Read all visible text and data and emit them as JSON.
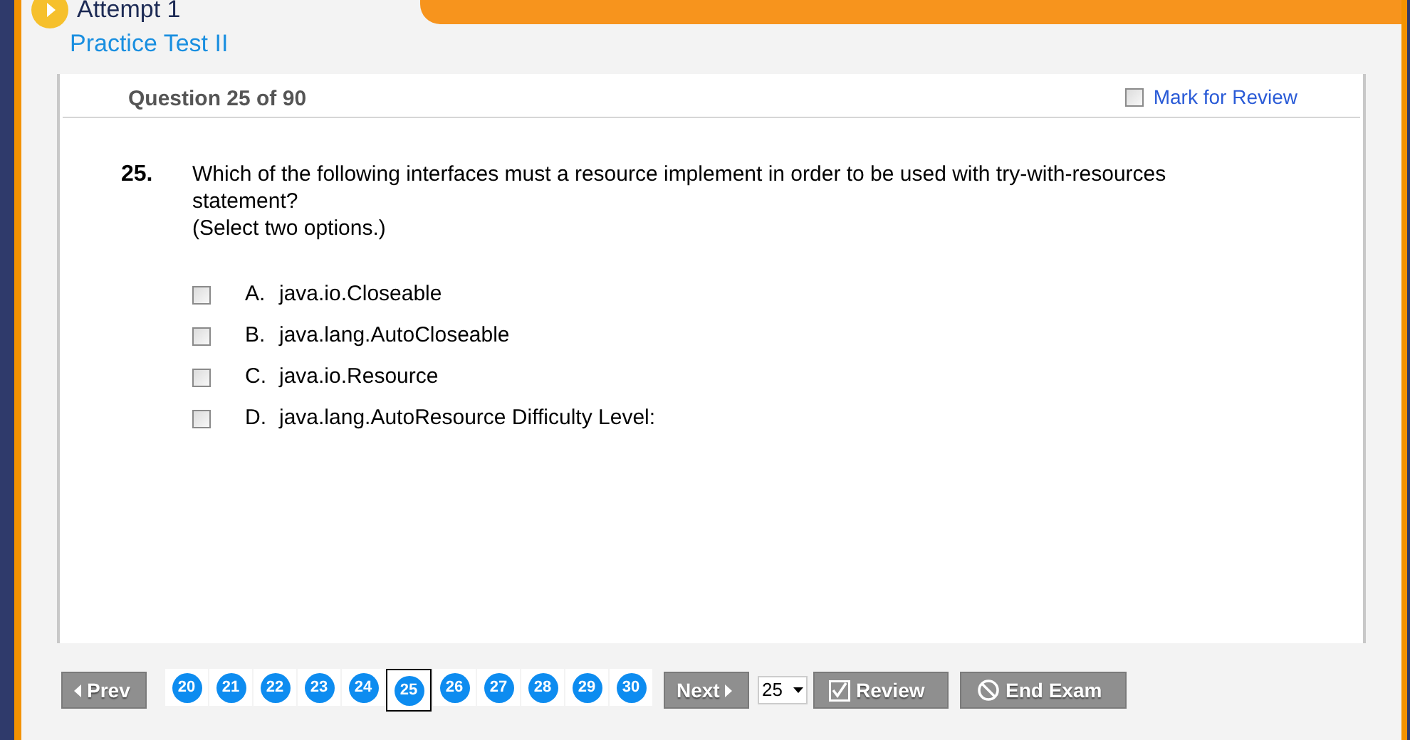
{
  "header": {
    "attempt": "Attempt 1",
    "test_name": "Practice Test II"
  },
  "question": {
    "heading": "Question 25 of 90",
    "mark_for_review": {
      "label": "Mark for Review",
      "checked": false
    },
    "number": "25.",
    "text": "Which of the following interfaces must a resource implement in order to be used with try-with-resources statement?",
    "instruction": "(Select two options.)",
    "options": [
      {
        "letter": "A.",
        "text": "java.io.Closeable",
        "checked": false
      },
      {
        "letter": "B.",
        "text": "java.lang.AutoCloseable",
        "checked": false
      },
      {
        "letter": "C.",
        "text": "java.io.Resource",
        "checked": false
      },
      {
        "letter": "D.",
        "text": "java.lang.AutoResource Difficulty Level:",
        "checked": false
      }
    ]
  },
  "footer": {
    "prev": "Prev",
    "pages": [
      {
        "label": "20",
        "selected": false
      },
      {
        "label": "21",
        "selected": false
      },
      {
        "label": "22",
        "selected": false
      },
      {
        "label": "23",
        "selected": false
      },
      {
        "label": "24",
        "selected": false
      },
      {
        "label": "25",
        "selected": true
      },
      {
        "label": "26",
        "selected": false
      },
      {
        "label": "27",
        "selected": false
      },
      {
        "label": "28",
        "selected": false
      },
      {
        "label": "29",
        "selected": false
      },
      {
        "label": "30",
        "selected": false
      }
    ],
    "next": "Next",
    "jump": "25",
    "review": "Review",
    "end_exam": "End Exam"
  }
}
